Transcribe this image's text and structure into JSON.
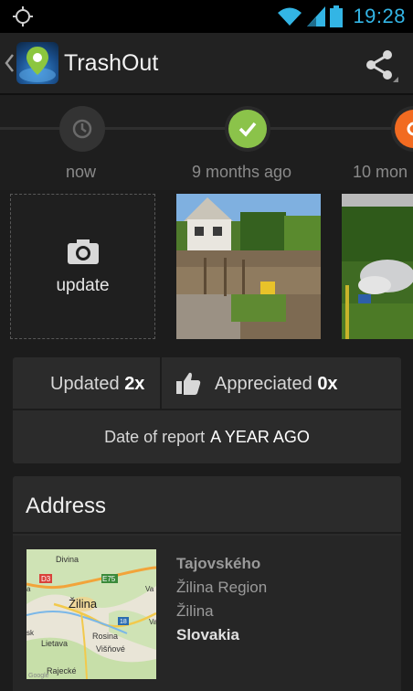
{
  "status_bar": {
    "time": "19:28",
    "icons": [
      "gps-icon",
      "wifi-icon",
      "signal-icon",
      "battery-icon"
    ]
  },
  "action_bar": {
    "title": "TrashOut",
    "icons": [
      "back-caret-icon",
      "app-logo-icon",
      "share-icon"
    ]
  },
  "timeline": {
    "items": [
      {
        "label": "now",
        "icon": "clock-icon",
        "color": "#333333"
      },
      {
        "label": "9 months ago",
        "icon": "checkmark-icon",
        "color": "#8bc34a"
      },
      {
        "label": "10 mon",
        "icon": "refresh-icon",
        "color": "#f26b21"
      }
    ]
  },
  "photos": {
    "update_label": "update",
    "update_icon": "camera-icon"
  },
  "stats": {
    "updated_label": "Updated",
    "updated_count": "2x",
    "appreciated_label": "Appreciated",
    "appreciated_count": "0x",
    "appreciated_icon": "thumbs-up-icon",
    "report_label": "Date of report",
    "report_value": "A YEAR AGO"
  },
  "address": {
    "title": "Address",
    "street": "Tajovského",
    "region": "Žilina Region",
    "city": "Žilina",
    "country": "Slovakia",
    "map_labels": {
      "town1": "Divina",
      "town2": "Žilina",
      "town3": "Lietava",
      "town4": "Rosina",
      "town5": "Višňové",
      "town6": "Rajecké",
      "road1": "D3",
      "road2": "E75",
      "road3": "18",
      "road4": "Va",
      "road5": "Va",
      "town7": "a",
      "town8": "sk",
      "attribution": "Google"
    }
  },
  "colors": {
    "accent_blue": "#33b5e5",
    "check_green": "#8bc34a",
    "orange": "#f26b21"
  }
}
